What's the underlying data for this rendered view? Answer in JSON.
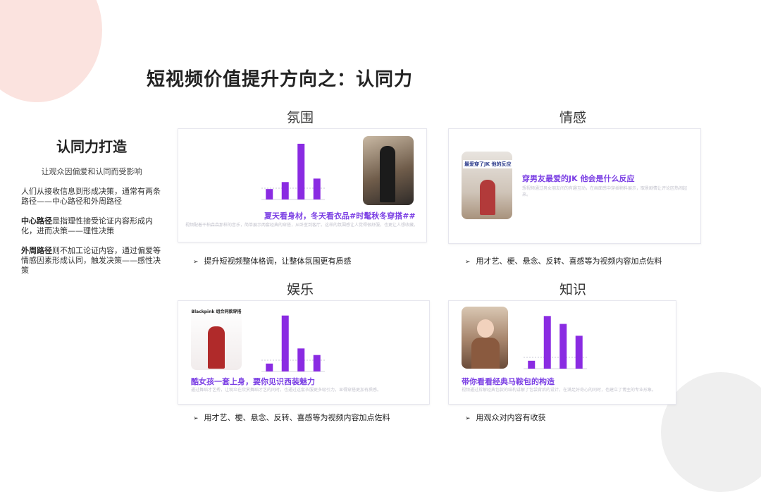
{
  "page": {
    "title": "短视频价值提升方向之：认同力"
  },
  "sidebar": {
    "heading": "认同力打造",
    "subtitle": "让观众因偏爱和认同而受影响",
    "p1": "人们从接收信息到形成决策，通常有两条路径——中心路径和外周路径",
    "p2_bold": "中心路径",
    "p2_rest": "是指理性接受论证内容形成内化，进而决策——理性决策",
    "p3_bold": "外周路径",
    "p3_rest": "则不加工论证内容，通过偏爱等情感因素形成认同，触发决策——感性决策"
  },
  "sections": [
    {
      "key": "atmosphere",
      "title": "氛围",
      "caption": "夏天看身材，冬天看衣品#时髦秋冬穿搭##",
      "blur": "视频配着干柏森森那样的音乐，简单展示两套经典的穿搭，从卧室到客厅。这样的氛围感让人觉得很舒服，也更让人想收藏。",
      "bullet": "提升短视频整体格调，让整体氛围更有质感",
      "chart": {
        "type": "bar",
        "values": [
          15,
          25,
          80,
          30
        ],
        "ylim": [
          0,
          85
        ],
        "color": "#8a2be2"
      }
    },
    {
      "key": "emotion",
      "title": "情感",
      "caption": "穿男友最爱的JK 他会是什么反应",
      "thumb_text": "最爱穿了JK 他的反应",
      "blur": "想视频通过男女朋友间的有趣互动，在画面感中穿插物料展示，取景剧情让评论区热闹起来。",
      "bullet": "用才艺、梗、悬念、反转、喜感等为视频内容加点佐料"
    },
    {
      "key": "entertainment",
      "title": "娱乐",
      "caption": "酷女孩一套上身，要你见识西装魅力",
      "thumb_text": "Blackpink 组合同款穿搭",
      "blur": "通过舞蹈才艺秀，让观众在欣赏舞蹈才艺的同时，也通过这套衣服更多吸引力，显得穿搭更加有质感。",
      "bullet": "用才艺、梗、悬念、反转、喜感等为视频内容加点佐料",
      "chart": {
        "type": "bar",
        "values": [
          12,
          85,
          35,
          25
        ],
        "ylim": [
          0,
          90
        ],
        "color": "#8a2be2"
      }
    },
    {
      "key": "knowledge",
      "title": "知识",
      "caption": "带你看看经典马鞍包的构造",
      "blur": "视频通过拆解经典包款的结构讲解了包袋背后的设计，在满足好奇心的同时，也建立了博主的专业形象。",
      "bullet": "用观众对内容有收获",
      "chart": {
        "type": "bar",
        "values": [
          12,
          80,
          68,
          50
        ],
        "ylim": [
          0,
          90
        ],
        "color": "#8a2be2"
      }
    }
  ],
  "colors": {
    "accent": "#8a2be2",
    "caption": "#7b3fe4",
    "deco_pink": "#fbe3df"
  }
}
